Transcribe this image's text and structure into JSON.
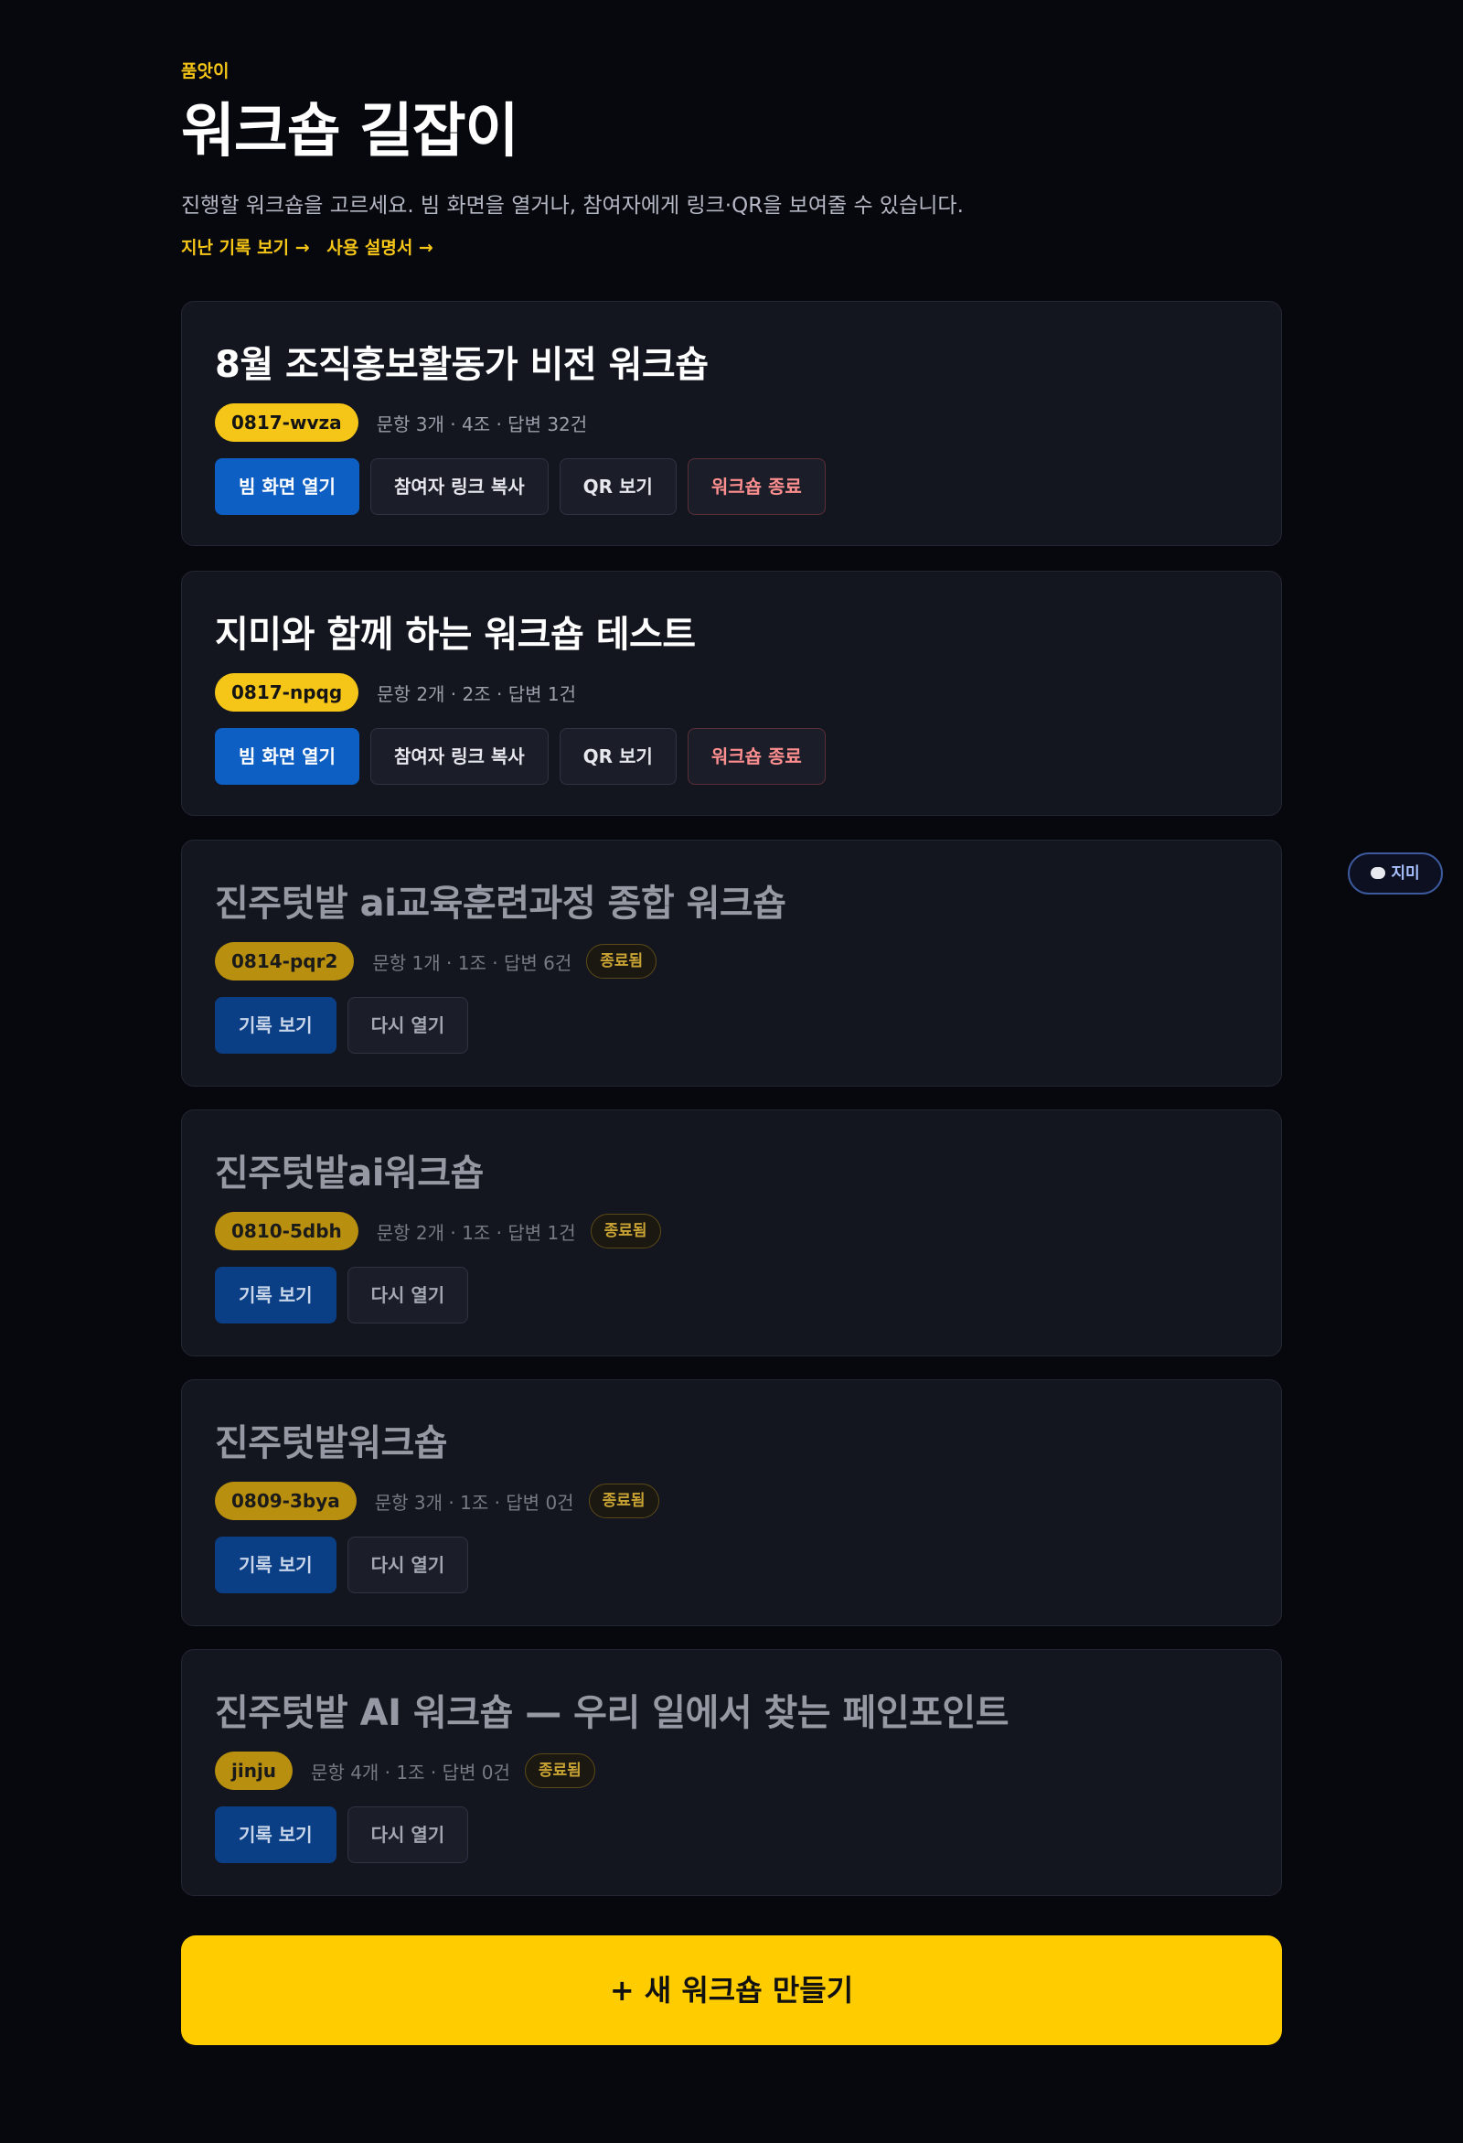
{
  "header": {
    "brand": "품앗이",
    "title": "워크숍 길잡이",
    "subtitle": "진행할 워크숍을 고르세요. 빔 화면을 열거나, 참여자에게 링크·QR을 보여줄 수 있습니다.",
    "links": [
      "지난 기록 보기 →",
      "사용 설명서 →"
    ]
  },
  "active_actions": {
    "open_beam": "빔 화면 열기",
    "copy_link": "참여자 링크 복사",
    "show_qr": "QR 보기",
    "end_workshop": "워크숍 종료"
  },
  "ended_actions": {
    "view_record": "기록 보기",
    "reopen": "다시 열기"
  },
  "ended_label": "종료됨",
  "workshops": [
    {
      "title": "8월 조직홍보활동가 비전 워크숍",
      "code": "0817-wvza",
      "meta": "문항 3개 · 4조 · 답변 32건",
      "ended": false
    },
    {
      "title": "지미와 함께 하는 워크숍 테스트",
      "code": "0817-npqg",
      "meta": "문항 2개 · 2조 · 답변 1건",
      "ended": false
    },
    {
      "title": "진주텃밭 ai교육훈련과정 종합 워크숍",
      "code": "0814-pqr2",
      "meta": "문항 1개 · 1조 · 답변 6건",
      "ended": true
    },
    {
      "title": "진주텃밭ai워크숍",
      "code": "0810-5dbh",
      "meta": "문항 2개 · 1조 · 답변 1건",
      "ended": true
    },
    {
      "title": "진주텃밭워크숍",
      "code": "0809-3bya",
      "meta": "문항 3개 · 1조 · 답변 0건",
      "ended": true
    },
    {
      "title": "진주텃밭 AI 워크숍 — 우리 일에서 찾는 페인포인트",
      "code": "jinju",
      "meta": "문항 4개 · 1조 · 답변 0건",
      "ended": true
    }
  ],
  "create_button": "+ 새 워크숍 만들기",
  "chat_fab": {
    "label": "지미",
    "icon": "chat-bubble-icon"
  },
  "colors": {
    "accent": "#ffcc00",
    "primary": "#0d5fc4",
    "background": "#07080d",
    "card": "#14161f",
    "danger": "#ff8f8f"
  }
}
